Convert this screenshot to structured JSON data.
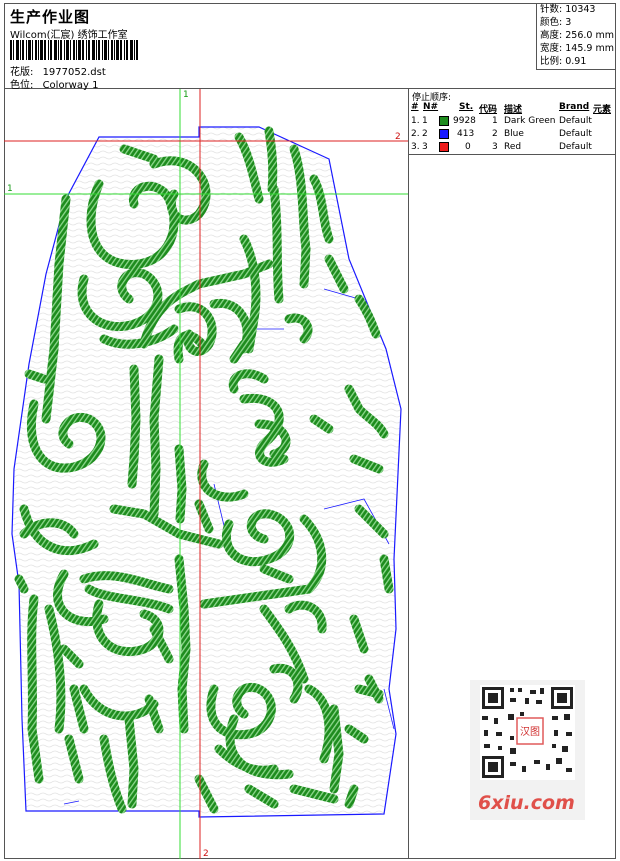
{
  "header": {
    "title": "生产作业图",
    "company": "Wilcom(汇宸) 绣饰工作室",
    "design_label": "花版:",
    "design_value": "1977052.dst",
    "colorway_label": "色位:",
    "colorway_value": "Colorway 1"
  },
  "stats": [
    {
      "label": "针数:",
      "value": "10343"
    },
    {
      "label": "颜色:",
      "value": "3"
    },
    {
      "label": "高度:",
      "value": "256.0 mm"
    },
    {
      "label": "宽度:",
      "value": "145.9 mm"
    },
    {
      "label": "比例:",
      "value": "0.91"
    }
  ],
  "legend": {
    "title": "停止顺序:",
    "headers": [
      "#",
      "N#",
      "St.",
      "代码",
      "描述",
      "Brand",
      "元素"
    ],
    "rows": [
      {
        "idx": "1.",
        "n": "1",
        "color": "#1e8c1e",
        "stitches": "9928",
        "code": "1",
        "desc": "Dark Green",
        "brand": "Default"
      },
      {
        "idx": "2.",
        "n": "2",
        "color": "#1a1aff",
        "stitches": "413",
        "code": "2",
        "desc": "Blue",
        "brand": "Default"
      },
      {
        "idx": "3.",
        "n": "3",
        "color": "#ee1c1c",
        "stitches": "0",
        "code": "3",
        "desc": "Red",
        "brand": "Default"
      }
    ]
  },
  "guides": {
    "v1_label": "1",
    "v2_label": "2",
    "h1_label": "1",
    "h2_label": "2",
    "guide_green": "#33dd33",
    "guide_red": "#dd2222",
    "outline_color": "#1a1aff",
    "stitch_color": "#1e8c1e"
  },
  "watermark": {
    "site": "6xiu.com",
    "seal_text": "汉图"
  }
}
